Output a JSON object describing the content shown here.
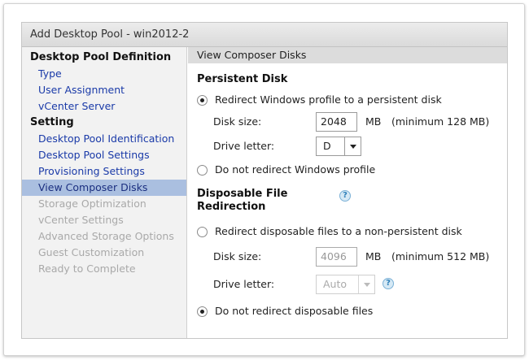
{
  "dialog": {
    "title": "Add Desktop Pool - win2012-2"
  },
  "sidebar": {
    "group1": "Desktop Pool Definition",
    "group1_items": [
      "Type",
      "User Assignment",
      "vCenter Server"
    ],
    "group2": "Setting",
    "group2_items": [
      {
        "label": "Desktop Pool Identification",
        "state": "link"
      },
      {
        "label": "Desktop Pool Settings",
        "state": "link"
      },
      {
        "label": "Provisioning Settings",
        "state": "link"
      },
      {
        "label": "View Composer Disks",
        "state": "active"
      },
      {
        "label": "Storage Optimization",
        "state": "disabled"
      },
      {
        "label": "vCenter Settings",
        "state": "disabled"
      },
      {
        "label": "Advanced Storage Options",
        "state": "disabled"
      },
      {
        "label": "Guest Customization",
        "state": "disabled"
      },
      {
        "label": "Ready to Complete",
        "state": "disabled"
      }
    ]
  },
  "main": {
    "section_title": "View Composer Disks",
    "persistent": {
      "heading": "Persistent Disk",
      "option_redirect": "Redirect Windows profile to a persistent disk",
      "option_redirect_selected": true,
      "disk_size_label": "Disk size:",
      "disk_size_value": "2048",
      "unit": "MB",
      "minimum": "(minimum 128 MB)",
      "drive_letter_label": "Drive letter:",
      "drive_letter_value": "D",
      "option_no_redirect": "Do not redirect Windows profile"
    },
    "disposable": {
      "heading_line1": "Disposable File",
      "heading_line2": "Redirection",
      "option_redirect": "Redirect disposable files to a non-persistent disk",
      "disk_size_label": "Disk size:",
      "disk_size_value": "4096",
      "unit": "MB",
      "minimum": "(minimum 512 MB)",
      "drive_letter_label": "Drive letter:",
      "drive_letter_value": "Auto",
      "option_no_redirect": "Do not redirect disposable files",
      "option_no_redirect_selected": true
    }
  },
  "icons": {
    "help": "?"
  }
}
